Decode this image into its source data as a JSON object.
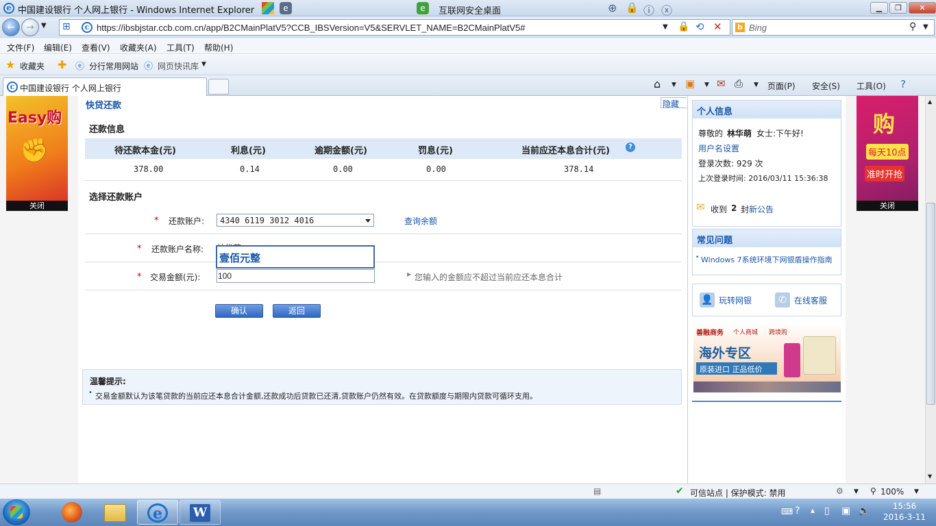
{
  "window": {
    "title": "中国建设银行 个人网上银行 - Windows Internet Explorer",
    "security_desktop": "互联网安全桌面"
  },
  "address": {
    "url": "https://ibsbjstar.ccb.com.cn/app/B2CMainPlatV5?CCB_IBSVersion=V5&SERVLET_NAME=B2CMainPlatV5#",
    "search_placeholder": "Bing"
  },
  "menu": [
    "文件(F)",
    "编辑(E)",
    "查看(V)",
    "收藏夹(A)",
    "工具(T)",
    "帮助(H)"
  ],
  "favorites": {
    "label": "收藏夹",
    "items": [
      "分行常用网站",
      "网页快讯库"
    ]
  },
  "tab": {
    "title": "中国建设银行 个人网上银行"
  },
  "commands": [
    "页面(P)",
    "安全(S)",
    "工具(O)"
  ],
  "ads": {
    "left_text": "Easy购",
    "right_text": "购",
    "right_sub1": "每天10点",
    "right_sub2": "准时开抢",
    "close": "关闭"
  },
  "main": {
    "title": "快贷还款",
    "hide": "隐藏",
    "repay_info_title": "还款信息",
    "columns": [
      "待还款本金(元)",
      "利息(元)",
      "逾期金额(元)",
      "罚息(元)",
      "当前应还本息合计(元)"
    ],
    "values": [
      "378.00",
      "0.14",
      "0.00",
      "0.00",
      "378.14"
    ],
    "select_title": "选择还款账户",
    "account_label": "还款账户:",
    "account_value": "4340 6119 3012 4016",
    "query_balance": "查询余额",
    "account_name_label": "还款账户名称:",
    "account_name_partial": "林华萌",
    "amount_label": "交易金额(元):",
    "amount_value": "100",
    "amount_uppercase": "壹佰元整",
    "amount_hint": "您输入的金额应不超过当前应还本息合计",
    "confirm": "确认",
    "back": "返回",
    "tip_title": "温馨提示:",
    "tip_text": "交易金额默认为该笔贷款的当前应还本息合计金额,还款成功后贷款已还清,贷款账户仍然有效。在贷款额度与期限内贷款可循环支用。"
  },
  "sidebar": {
    "personal_title": "个人信息",
    "greeting_prefix": "尊敬的",
    "user_name": "林华萌",
    "greeting_suffix": "女士:下午好!",
    "username_settings": "用户名设置",
    "login_count": "登录次数: 929 次",
    "last_login": "上次登录时间: 2016/03/11 15:36:38",
    "notice_prefix": "收到",
    "notice_count": "2",
    "notice_mid": "封",
    "notice_link": "新公告",
    "faq_title": "常见问题",
    "faq_item": "Windows 7系统环境下网银盾操作指南",
    "play_bank": "玩转网银",
    "online_service": "在线客服",
    "promo_header": "善融商务",
    "promo_sub1": "个人商城",
    "promo_sub2": "跨境购",
    "promo_title": "海外专区",
    "promo_desc": "原装进口 正品低价"
  },
  "status": {
    "zone": "可信站点 | 保护模式: 禁用",
    "zoom": "100%"
  },
  "taskbar": {
    "time": "15:56",
    "date": "2016-3-11"
  }
}
